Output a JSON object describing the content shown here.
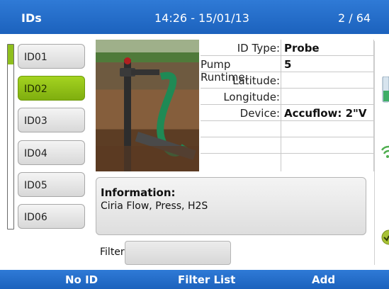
{
  "header": {
    "title": "IDs",
    "datetime": "14:26 - 15/01/13",
    "counter": "2 / 64"
  },
  "id_list": {
    "items": [
      {
        "label": "ID01",
        "selected": false
      },
      {
        "label": "ID02",
        "selected": true
      },
      {
        "label": "ID03",
        "selected": false
      },
      {
        "label": "ID04",
        "selected": false
      },
      {
        "label": "ID05",
        "selected": false
      },
      {
        "label": "ID06",
        "selected": false
      }
    ]
  },
  "details": {
    "rows": [
      {
        "label": "ID Type:",
        "value": "Probe"
      },
      {
        "label": "Pump Runtime:",
        "value": "5"
      },
      {
        "label": "Latitude:",
        "value": ""
      },
      {
        "label": "Longitude:",
        "value": ""
      },
      {
        "label": "Device:",
        "value": "Accuflow: 2\"V"
      },
      {
        "label": "",
        "value": ""
      },
      {
        "label": "",
        "value": ""
      }
    ]
  },
  "information": {
    "heading": "Information:",
    "text": "Ciria Flow, Press, H2S"
  },
  "filter": {
    "label": "Filter",
    "value": ""
  },
  "softkeys": {
    "left": "No ID",
    "middle": "Filter List",
    "right": "Add"
  },
  "colors": {
    "bar_blue": "#1c62bd",
    "selection_green": "#8fbf1e"
  },
  "icons": [
    "battery-icon",
    "wifi-signal-icon",
    "check-status-icon"
  ]
}
